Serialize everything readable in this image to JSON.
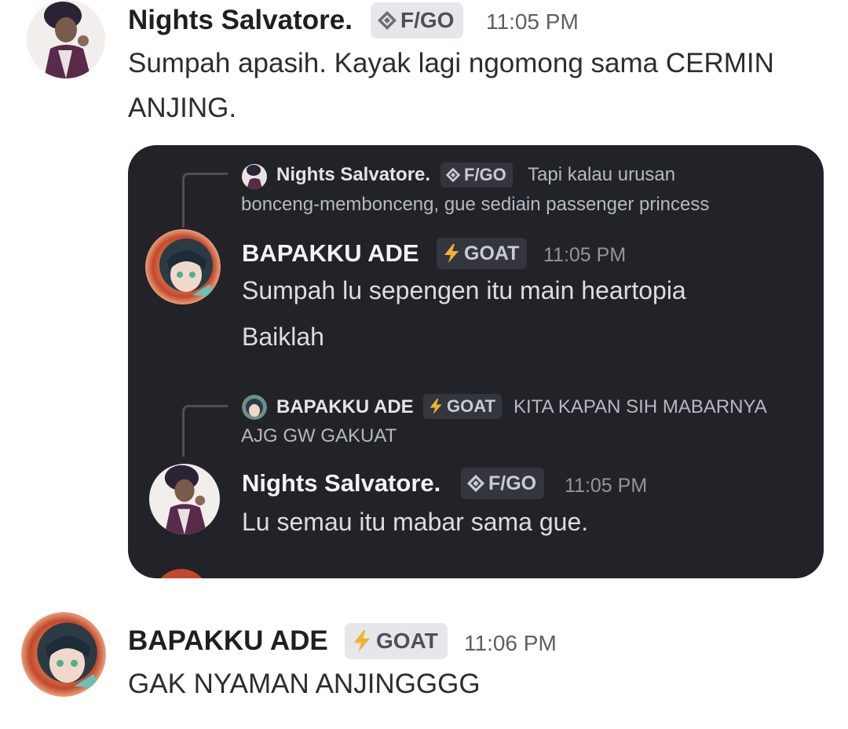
{
  "messages": [
    {
      "author": "Nights Salvatore.",
      "badge": {
        "icon": "diamond-icon",
        "label": "F/GO"
      },
      "time": "11:05 PM",
      "lines": [
        "Sumpah apasih. Kayak lagi ngomong sama CERMIN",
        "ANJING."
      ]
    },
    {
      "author": "BAPAKKU ADE",
      "badge": {
        "icon": "lightning-icon",
        "label": "GOAT"
      },
      "time": "11:06 PM",
      "lines": [
        "GAK NYAMAN ANJINGGGG"
      ]
    }
  ],
  "embed": {
    "reply1": {
      "author": "Nights Salvatore.",
      "badge": {
        "icon": "diamond-icon",
        "label": "F/GO"
      },
      "text_line1": "Tapi kalau urusan",
      "text_line2": "bonceng-membonceng, gue sediain passenger princess"
    },
    "msg1": {
      "author": "BAPAKKU ADE",
      "badge": {
        "icon": "lightning-icon",
        "label": "GOAT"
      },
      "time": "11:05 PM",
      "lines": [
        "Sumpah lu sepengen itu main heartopia",
        "Baiklah"
      ]
    },
    "reply2": {
      "author": "BAPAKKU ADE",
      "badge": {
        "icon": "lightning-icon",
        "label": "GOAT"
      },
      "text_line1": "KITA KAPAN SIH MABARNYA",
      "text_line2": "AJG GW GAKUAT"
    },
    "msg2": {
      "author": "Nights Salvatore.",
      "badge": {
        "icon": "diamond-icon",
        "label": "F/GO"
      },
      "time": "11:05 PM",
      "lines": [
        "Lu semau itu mabar sama gue."
      ]
    }
  },
  "colors": {
    "embed_background": "#212329",
    "badge_light": "#e6e7ea",
    "badge_dark": "#34363d",
    "lightning": "#f0b232"
  }
}
